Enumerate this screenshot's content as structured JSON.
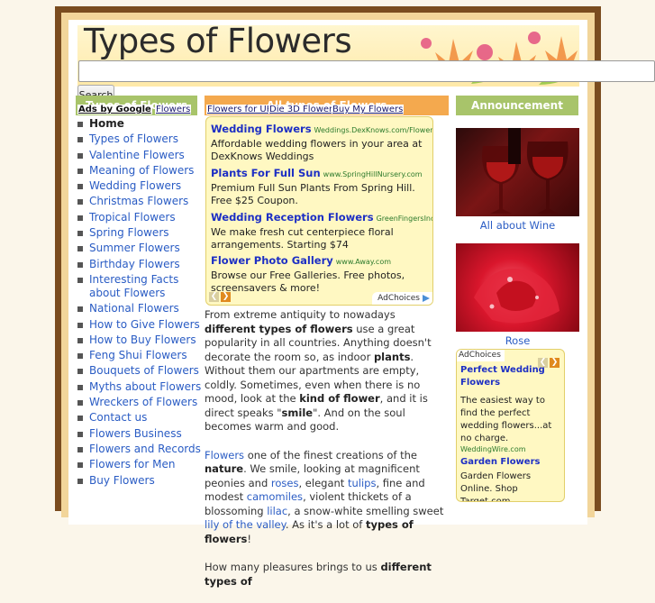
{
  "site": {
    "title": "Types of Flowers"
  },
  "search": {
    "value": "",
    "button_label": "Search"
  },
  "headers": {
    "left": "Types of Flowers",
    "middle": "All types of Flowers",
    "right": "Announcement"
  },
  "ad_links": {
    "label": "Ads by Google",
    "items": [
      "Flowers",
      "Flowers for UK",
      "Die 3D Flowers",
      "Buy My Flowers"
    ]
  },
  "menu": {
    "items": [
      "Home",
      "Types of Flowers",
      "Valentine Flowers",
      "Meaning of Flowers",
      "Wedding Flowers",
      "Christmas Flowers",
      "Tropical Flowers",
      "Spring Flowers",
      "Summer Flowers",
      "Birthday Flowers",
      "Interesting Facts about Flowers",
      "National Flowers",
      "How to Give Flowers",
      "How to Buy Flowers",
      "Feng Shui Flowers",
      "Bouquets of Flowers",
      "Myths about Flowers",
      "Wreckers of Flowers",
      "Contact us",
      "Flowers Business",
      "Flowers and Records",
      "Flowers for Men",
      "Buy Flowers"
    ]
  },
  "ads_main": {
    "items": [
      {
        "title": "Wedding Flowers",
        "url": "Weddings.DexKnows.com/Flowers",
        "desc": "Affordable wedding flowers in your area at DexKnows Weddings"
      },
      {
        "title": "Plants For Full Sun",
        "url": "www.SpringHillNursery.com",
        "desc": "Premium Full Sun Plants From Spring Hill. Free $25 Coupon."
      },
      {
        "title": "Wedding Reception Flowers",
        "url": "GreenFingersInc.com",
        "desc": "We make fresh cut centerpiece floral arrangements. Starting $74"
      },
      {
        "title": "Flower Photo Gallery",
        "url": "www.Away.com",
        "desc": "Browse our Free Galleries. Free photos, screensavers & more!"
      }
    ],
    "adchoices": "AdChoices"
  },
  "article": {
    "p1": {
      "a": "From extreme antiquity to nowadays ",
      "b": "different types of flowers",
      "c": " use a great popularity in all countries. Anything doesn't decorate the room so, as indoor ",
      "d": "plants",
      "e": ". Without them our apartments are empty, coldly. Sometimes, even when there is no mood, look at the ",
      "f": "kind of flower",
      "g": ", and it is direct speaks \"",
      "h": "smile",
      "i": "\". And on the soul becomes warm and good."
    },
    "p2": {
      "a": "Flowers",
      "b": " one of the finest creations of the ",
      "c": "nature",
      "d": ". We smile, looking at magnificent peonies and ",
      "e": "roses",
      "f": ", elegant ",
      "g": "tulips",
      "h": ", fine and modest ",
      "i": "camomiles",
      "j": ", violent thickets of a blossoming ",
      "k": "lilac",
      "l": ", a snow-white smelling sweet ",
      "m": "lily of the valley",
      "n": ". As it's a lot of ",
      "o": "types of flowers",
      "p": "!"
    },
    "p3": {
      "a": "How many pleasures brings to us ",
      "b": "different types of"
    }
  },
  "sidebar": {
    "wine_caption": "All about Wine",
    "rose_caption": "Rose",
    "adchoices": "AdChoices",
    "ads": [
      {
        "title": "Perfect Wedding Flowers",
        "desc": "The easiest way to find the perfect wedding flowers...at no charge.",
        "url": "WeddingWire.com"
      },
      {
        "title": "Garden Flowers",
        "desc": "Garden Flowers Online. Shop Target.com.",
        "url": ""
      }
    ]
  },
  "colors": {
    "frame": "#7a4c1f",
    "header_green": "#a8c46a",
    "header_orange": "#f4a94e",
    "ad_background": "#fff8c2",
    "link": "#2a5cc4"
  }
}
